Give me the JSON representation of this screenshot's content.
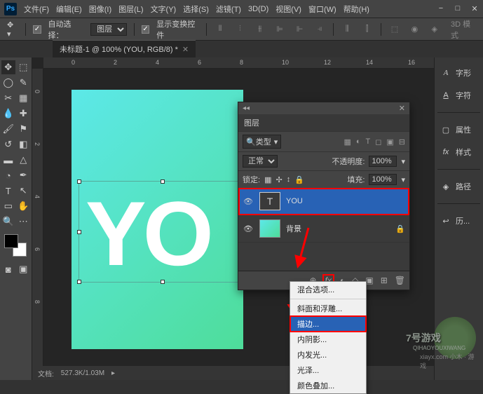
{
  "menubar": {
    "logo": "Ps",
    "items": [
      "文件(F)",
      "编辑(E)",
      "图像(I)",
      "图层(L)",
      "文字(Y)",
      "选择(S)",
      "滤镜(T)",
      "3D(D)",
      "视图(V)",
      "窗口(W)",
      "帮助(H)"
    ]
  },
  "optionsbar": {
    "auto_select_label": "自动选择：",
    "auto_select_dropdown": "图层",
    "show_transform_label": "显示变换控件",
    "mode_3d": "3D 模式"
  },
  "doc_tab": {
    "title": "未标题-1 @ 100% (YOU, RGB/8) *"
  },
  "ruler_h_ticks": [
    "0",
    "2",
    "4",
    "6",
    "8",
    "10",
    "12",
    "14",
    "16"
  ],
  "ruler_v_ticks": [
    "0",
    "2",
    "4",
    "6",
    "8"
  ],
  "canvas": {
    "text": "YO"
  },
  "status": {
    "doc_label": "文档:",
    "doc_size": "527.3K/1.03M"
  },
  "right_panel": {
    "items": [
      {
        "icon": "A",
        "label": "字形"
      },
      {
        "icon": "A",
        "label": "字符"
      },
      {
        "icon": "▢",
        "label": "属性"
      },
      {
        "icon": "fx",
        "label": "样式"
      },
      {
        "icon": "◈",
        "label": "路径"
      },
      {
        "icon": "↩",
        "label": "历..."
      }
    ]
  },
  "layers_panel": {
    "title": "图层",
    "kind_label": "类型",
    "blend_mode": "正常",
    "opacity_label": "不透明度:",
    "opacity_value": "100%",
    "lock_label": "锁定:",
    "fill_label": "填充:",
    "fill_value": "100%",
    "layers": [
      {
        "name": "YOU",
        "type": "text",
        "visible": true
      },
      {
        "name": "背景",
        "type": "bg",
        "visible": true,
        "locked": true
      }
    ],
    "footer_icons": [
      "⊕",
      "fx",
      "◐",
      "◇",
      "▣",
      "⊞",
      "🗑"
    ]
  },
  "fx_menu": {
    "items": [
      {
        "label": "混合选项...",
        "sep_after": true
      },
      {
        "label": "斜面和浮雕..."
      },
      {
        "label": "描边...",
        "selected": true
      },
      {
        "label": "内阴影..."
      },
      {
        "label": "内发光..."
      },
      {
        "label": "光泽..."
      },
      {
        "label": "颜色叠加..."
      }
    ]
  },
  "watermark": {
    "main": "7号游戏",
    "pinyin": "QIHAOYOUXIWANG",
    "url": "xiayx.com",
    "sub": "小木 · 游戏"
  }
}
